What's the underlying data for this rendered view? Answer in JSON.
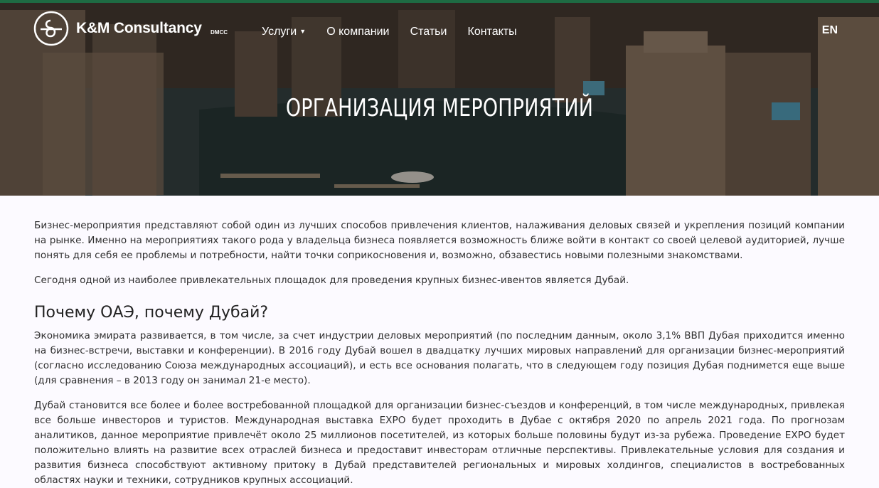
{
  "header": {
    "brand": "K&M Consultancy",
    "brand_suffix": "DMCC",
    "logo_icon": "km-monogram-icon",
    "menu": [
      {
        "label": "Услуги",
        "has_dropdown": true
      },
      {
        "label": "О компании"
      },
      {
        "label": "Статьи"
      },
      {
        "label": "Контакты"
      }
    ],
    "language": "EN"
  },
  "hero": {
    "title": "ОРГАНИЗАЦИЯ МЕРОПРИЯТИЙ"
  },
  "article": {
    "intro_1": "Бизнес-мероприятия представляют собой один из лучших способов привлечения клиентов, налаживания деловых связей и укрепления позиций компании на рынке. Именно на мероприятиях такого рода у владельца бизнеса появляется возможность ближе войти в контакт со своей целевой аудиторией, лучше понять для себя ее проблемы и потребности, найти точки соприкосновения и, возможно, обзавестись новыми полезными знакомствами.",
    "intro_2": "Сегодня одной из наиболее привлекательных площадок для проведения крупных бизнес-ивентов является Дубай.",
    "heading": "Почему ОАЭ, почему Дубай?",
    "para_1": "Экономика эмирата развивается, в том числе, за счет индустрии деловых мероприятий (по последним данным, около 3,1% ВВП Дубая приходится именно на бизнес-встречи, выставки и конференции). В 2016 году Дубай вошел в двадцатку лучших мировых направлений для организации бизнес-мероприятий (согласно исследованию Союза международных ассоциаций), и есть все основания полагать, что в следующем году позиция Дубая поднимется еще выше (для сравнения – в 2013 году он занимал 21-е место).",
    "para_2": "Дубай становится все более и более востребованной площадкой для организации бизнес-съездов и конференций, в том числе международных, привлекая все больше инвесторов и туристов. Международная выставка EXPO будет проходить в Дубае с октября 2020 по апрель 2021 года. По прогнозам аналитиков, данное мероприятие привлечёт около 25 миллионов посетителей, из которых больше половины будут из-за рубежа. Проведение EXPO будет положительно влиять на развитие всех отраслей бизнеса и предоставит инвесторам отличные перспективы.  Привлекательные условия для создания и развития бизнеса способствуют активному притоку в Дубай представителей региональных и мировых холдингов, специалистов в востребованных областях науки и техники, сотрудников крупных ассоциаций."
  },
  "colors": {
    "top_bar": "#1e6b43",
    "page_background": "#fcfaff",
    "text": "#2f2f2f"
  }
}
